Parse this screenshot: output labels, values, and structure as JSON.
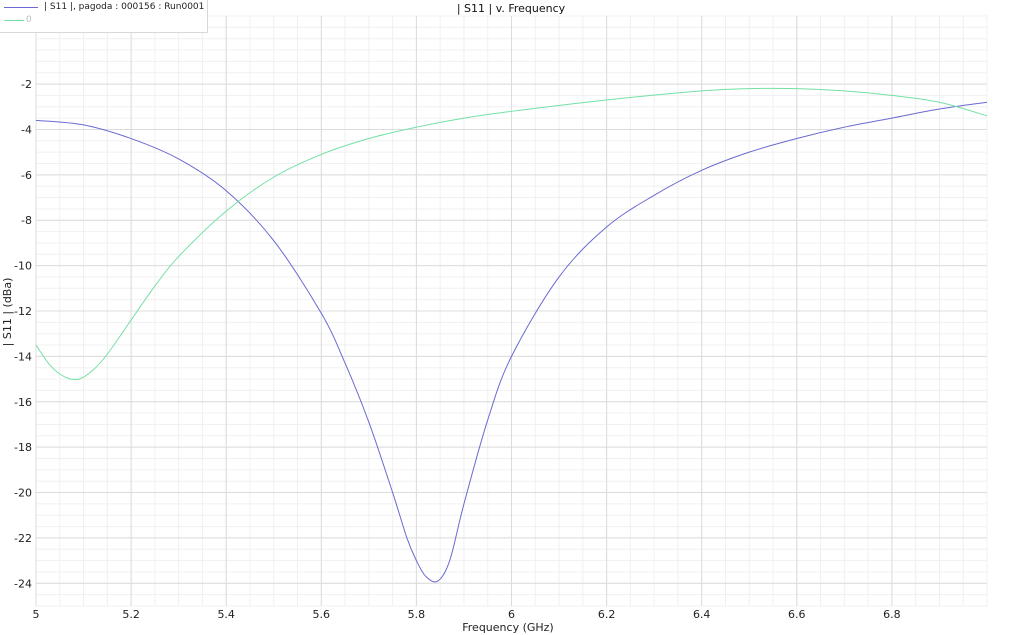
{
  "chart_data": {
    "type": "line",
    "title": "| S11 | v. Frequency",
    "xlabel": "Frequency (GHz)",
    "ylabel": "| S11 | (dBa)",
    "xlim": [
      5.0,
      7.0
    ],
    "ylim": [
      -25,
      1.0
    ],
    "x_ticks": [
      5,
      5.2,
      5.4,
      5.6,
      5.8,
      6,
      6.2,
      6.4,
      6.6,
      6.8
    ],
    "x_tick_labels": [
      "5",
      "5.2",
      "5.4",
      "5.6",
      "5.8",
      "6",
      "6.2",
      "6.4",
      "6.6",
      "6.8"
    ],
    "y_ticks": [
      -2,
      -4,
      -6,
      -8,
      -10,
      -12,
      -14,
      -16,
      -18,
      -20,
      -22,
      -24
    ],
    "y_tick_labels": [
      "-2",
      "-4",
      "-6",
      "-8",
      "-10",
      "-12",
      "-14",
      "-16",
      "-18",
      "-20",
      "-22",
      "-24"
    ],
    "grid": true,
    "legend_position": "top-left",
    "series": [
      {
        "name": "| S11 |, pagoda : 000156 : Run0001",
        "color": "#6a6ad2",
        "x": [
          5.0,
          5.1,
          5.2,
          5.3,
          5.4,
          5.5,
          5.6,
          5.65,
          5.7,
          5.75,
          5.78,
          5.8,
          5.82,
          5.845,
          5.87,
          5.9,
          5.95,
          6.0,
          6.1,
          6.2,
          6.3,
          6.4,
          6.5,
          6.6,
          6.7,
          6.8,
          6.9,
          7.0
        ],
        "y": [
          -3.6,
          -3.8,
          -4.4,
          -5.3,
          -6.7,
          -8.9,
          -12.1,
          -14.3,
          -16.9,
          -20.0,
          -22.0,
          -23.0,
          -23.7,
          -23.9,
          -23.0,
          -20.5,
          -16.8,
          -14.0,
          -10.5,
          -8.3,
          -6.9,
          -5.8,
          -5.0,
          -4.4,
          -3.9,
          -3.5,
          -3.1,
          -2.8
        ]
      },
      {
        "name": "0",
        "color": "#74e0a4",
        "x": [
          5.0,
          5.03,
          5.06,
          5.09,
          5.12,
          5.15,
          5.2,
          5.25,
          5.3,
          5.4,
          5.5,
          5.6,
          5.7,
          5.8,
          5.9,
          6.0,
          6.2,
          6.4,
          6.5,
          6.6,
          6.7,
          6.8,
          6.9,
          7.0
        ],
        "y": [
          -13.5,
          -14.4,
          -14.9,
          -15.0,
          -14.6,
          -13.9,
          -12.4,
          -10.9,
          -9.6,
          -7.6,
          -6.1,
          -5.1,
          -4.4,
          -3.9,
          -3.5,
          -3.2,
          -2.7,
          -2.3,
          -2.2,
          -2.2,
          -2.3,
          -2.5,
          -2.8,
          -3.4
        ]
      }
    ]
  }
}
